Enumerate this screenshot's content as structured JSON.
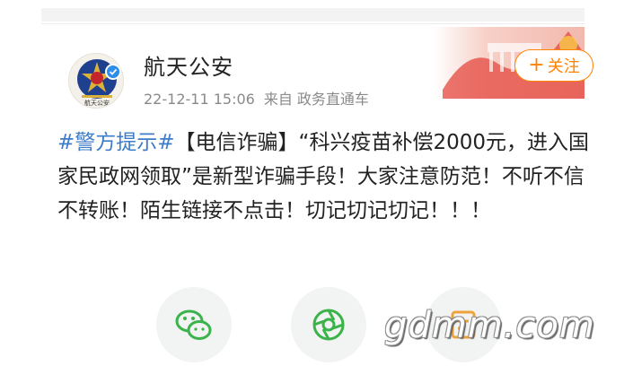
{
  "account": {
    "name": "航天公安",
    "avatar_caption": "航天公安",
    "date": "22-12-11 15:06",
    "source": "来自 政务直通车"
  },
  "follow": {
    "plus": "+",
    "label": "关注"
  },
  "post": {
    "hashtag": "#警方提示#",
    "body": "【电信诈骗】“科兴疫苗补偿2000元，进入国家民政网领取”是新型诈骗手段！大家注意防范！不听不信不转账！陌生链接不点击！切记切记切记！！！"
  },
  "actions": [
    {
      "icon": "wechat-icon",
      "color": "#3cb34a"
    },
    {
      "icon": "moments-icon",
      "color": "#3cb34a"
    },
    {
      "icon": "favorite-icon",
      "color": "#f0a23a"
    }
  ],
  "watermark": "gdmm.com",
  "colors": {
    "accent": "#ff8200",
    "hashtag": "#3d7cc9",
    "verified": "#2d8ee8"
  }
}
